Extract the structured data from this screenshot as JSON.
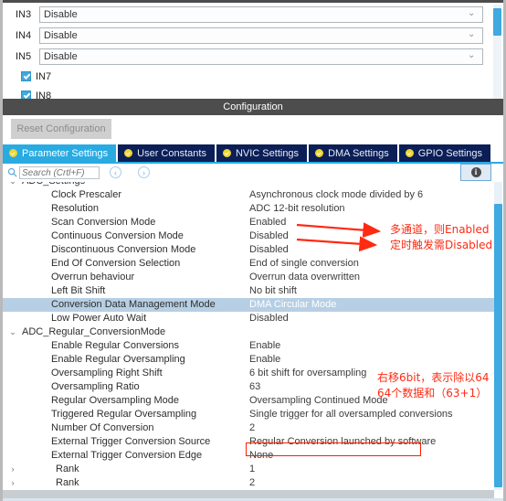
{
  "top_panel": {
    "inputs": [
      {
        "label": "IN3",
        "value": "Disable"
      },
      {
        "label": "IN4",
        "value": "Disable"
      },
      {
        "label": "IN5",
        "value": "Disable"
      }
    ],
    "checkboxes": [
      {
        "label": "IN7",
        "checked": true
      },
      {
        "label": "IN8",
        "checked": true
      }
    ]
  },
  "config": {
    "title": "Configuration",
    "reset_button": "Reset Configuration",
    "tabs": [
      {
        "label": "Parameter Settings",
        "active": true
      },
      {
        "label": "User Constants",
        "active": false
      },
      {
        "label": "NVIC Settings",
        "active": false
      },
      {
        "label": "DMA Settings",
        "active": false
      },
      {
        "label": "GPIO Settings",
        "active": false
      }
    ],
    "search": {
      "placeholder": "Search (Crtl+F)",
      "value": ""
    },
    "nav": {
      "prev": "‹",
      "next": "›"
    },
    "info_label": "i"
  },
  "tree": {
    "rows": [
      {
        "type": "group",
        "arrow": "⌄",
        "name": "ADC_Settings",
        "value": ""
      },
      {
        "type": "item",
        "name": "Clock Prescaler",
        "value": "Asynchronous clock mode divided by 6"
      },
      {
        "type": "item",
        "name": "Resolution",
        "value": "ADC 12-bit resolution"
      },
      {
        "type": "item",
        "name": "Scan Conversion Mode",
        "value": "Enabled"
      },
      {
        "type": "item",
        "name": "Continuous Conversion Mode",
        "value": "Disabled"
      },
      {
        "type": "item",
        "name": "Discontinuous Conversion Mode",
        "value": "Disabled"
      },
      {
        "type": "item",
        "name": "End Of Conversion Selection",
        "value": "End of single conversion"
      },
      {
        "type": "item",
        "name": "Overrun behaviour",
        "value": "Overrun data overwritten"
      },
      {
        "type": "item",
        "name": "Left Bit Shift",
        "value": "No bit shift"
      },
      {
        "type": "item",
        "name": "Conversion Data Management Mode",
        "value": "DMA Circular Mode",
        "selected": true
      },
      {
        "type": "item",
        "name": "Low Power Auto Wait",
        "value": "Disabled"
      },
      {
        "type": "group",
        "arrow": "⌄",
        "name": "ADC_Regular_ConversionMode",
        "value": ""
      },
      {
        "type": "item",
        "name": "Enable Regular Conversions",
        "value": "Enable"
      },
      {
        "type": "item",
        "name": "Enable Regular Oversampling",
        "value": "Enable"
      },
      {
        "type": "item",
        "name": "Oversampling Right Shift",
        "value": "6 bit shift for oversampling"
      },
      {
        "type": "item",
        "name": "Oversampling Ratio",
        "value": "63"
      },
      {
        "type": "item",
        "name": "Regular Oversampling Mode",
        "value": "Oversampling Continued Mode"
      },
      {
        "type": "item",
        "name": "Triggered Regular Oversampling",
        "value": "Single trigger for all oversampled conversions"
      },
      {
        "type": "item",
        "name": "Number Of Conversion",
        "value": "2"
      },
      {
        "type": "item",
        "name": "External Trigger Conversion Source",
        "value": "Regular Conversion launched by software"
      },
      {
        "type": "item",
        "name": "External Trigger Conversion Edge",
        "value": "None"
      },
      {
        "type": "rank",
        "arrow": "›",
        "name": "Rank",
        "value": "1"
      },
      {
        "type": "rank",
        "arrow": "›",
        "name": "Rank",
        "value": "2"
      }
    ]
  },
  "annotations": {
    "color": "#ff2a12",
    "notes": [
      {
        "id": "note-scan",
        "text": "多通道，则Enabled"
      },
      {
        "id": "note-trigger",
        "text": "定时触发需Disabled"
      },
      {
        "id": "note-shift",
        "text": "右移6bit，表示除以64"
      },
      {
        "id": "note-sum",
        "text": "64个数据和（63+1）"
      }
    ]
  }
}
